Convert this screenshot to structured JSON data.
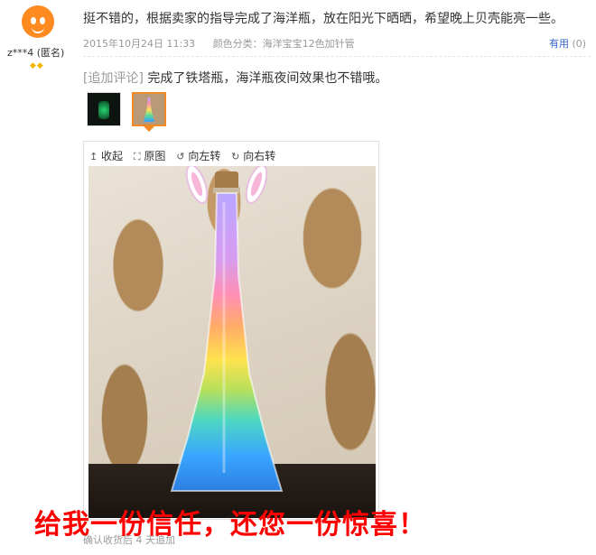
{
  "reviewer": {
    "username": "z***4 (匿名)",
    "badges": "◆◆"
  },
  "review": {
    "text": "挺不错的，根据卖家的指导完成了海洋瓶，放在阳光下晒晒，希望晚上贝壳能亮一些。",
    "date": "2015年10月24日 11:33",
    "color_category": "颜色分类：海洋宝宝12色加针管",
    "useful_label": "有用",
    "useful_count": "(0)"
  },
  "append": {
    "tag": "[追加评论]",
    "text": "完成了铁塔瓶，海洋瓶夜间效果也不错哦。"
  },
  "thumbnails": [
    {
      "name": "glow-bottle"
    },
    {
      "name": "rainbow-tower-bottle",
      "selected": true
    }
  ],
  "viewer": {
    "collapse": "收起",
    "original": "原图",
    "rotate_left": "向左转",
    "rotate_right": "向右转"
  },
  "overlay": {
    "slogan": "给我一份信任，还您一份惊喜！"
  },
  "footer": {
    "confirm_text": "确认收货后 4 天追加"
  },
  "colors": {
    "link": "#3366cc",
    "accent": "#f08a24",
    "slogan": "#ff0000"
  }
}
